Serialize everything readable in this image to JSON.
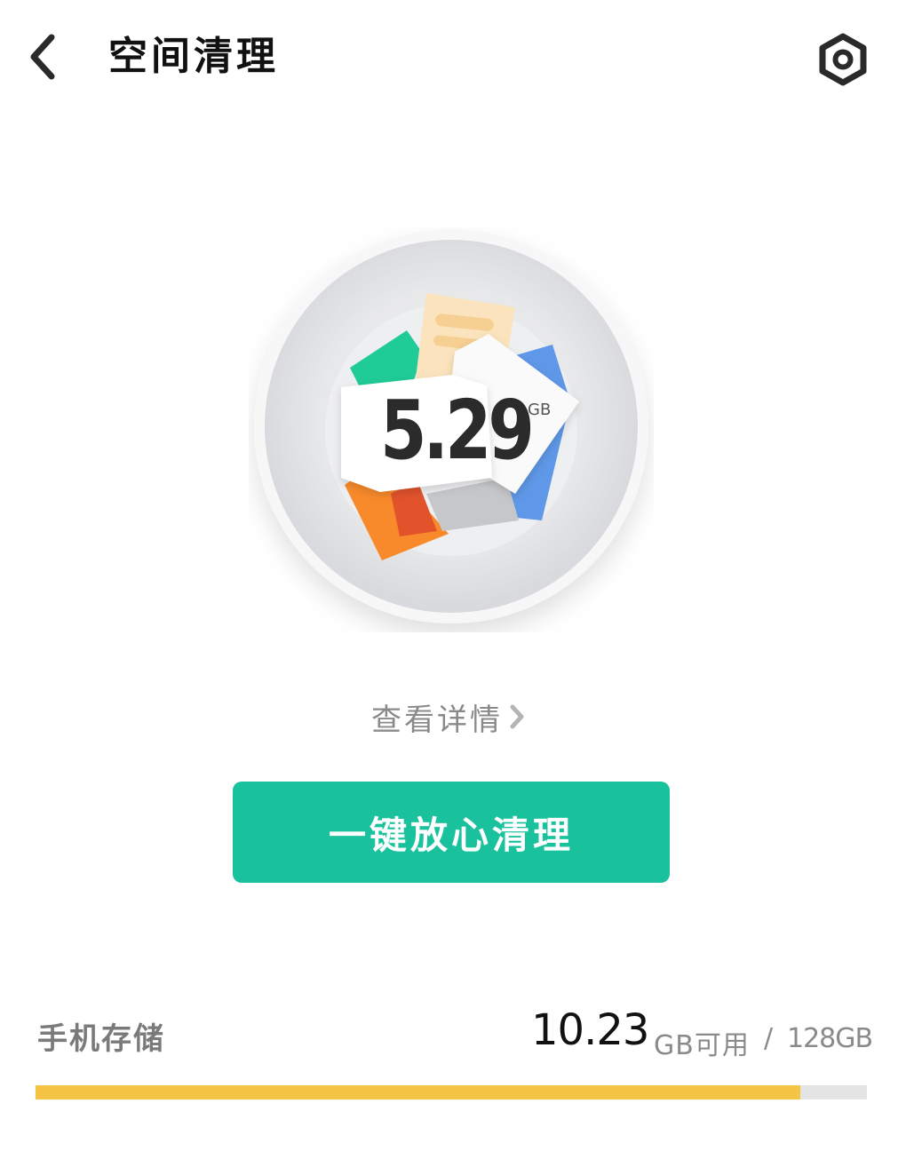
{
  "header": {
    "back_icon": "chevron-left-icon",
    "title": "空间清理",
    "settings_icon": "hexagon-settings-icon"
  },
  "gauge": {
    "amount": "5.29",
    "unit": "GB",
    "icon": "file-stack-illustration"
  },
  "details_link": {
    "label": "查看详情",
    "icon": "chevron-right-icon"
  },
  "clean_button": {
    "label": "一键放心清理",
    "color": "#19c29c"
  },
  "storage": {
    "label": "手机存储",
    "available": "10.23",
    "available_unit": "GB可用",
    "separator": "/",
    "total": "128GB",
    "used_fraction": 0.92,
    "bar_color": "#f6c445",
    "track_color": "#e4e4e4"
  }
}
